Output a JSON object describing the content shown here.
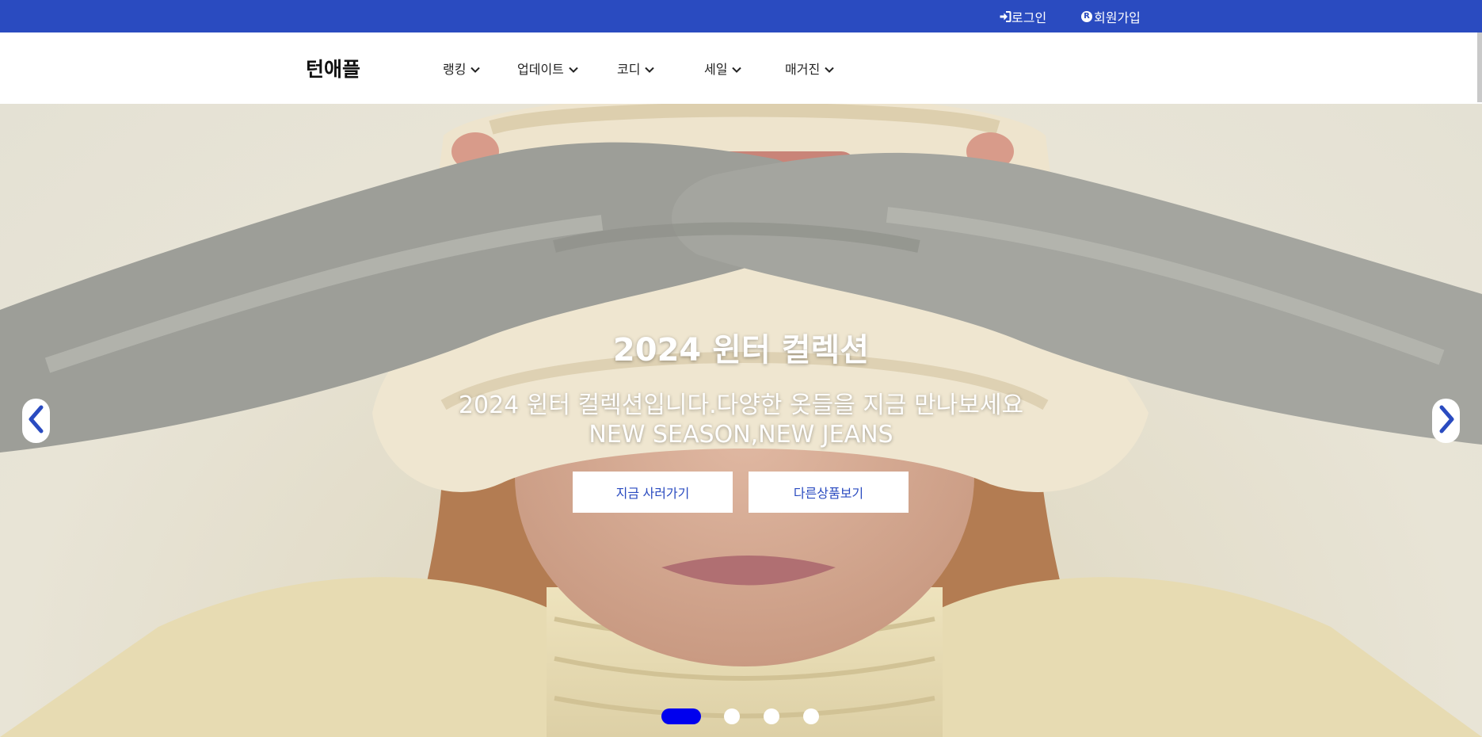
{
  "topbar": {
    "background": "#2a4bc0",
    "login_label": "로그인",
    "login_icon": "sign-in-icon",
    "signup_label": "회원가입",
    "signup_icon": "registered-icon",
    "signup_badge": "R"
  },
  "header": {
    "brand": "턴애플",
    "nav": [
      {
        "label": "랭킹",
        "icon": "chevron-down-icon"
      },
      {
        "label": "업데이트",
        "icon": "chevron-down-icon"
      },
      {
        "label": "코디",
        "icon": "chevron-down-icon"
      },
      {
        "label": "세일",
        "icon": "chevron-down-icon"
      },
      {
        "label": "매거진",
        "icon": "chevron-down-icon"
      }
    ]
  },
  "hero": {
    "title": "2024 윈터 컬렉션",
    "subtitle_line1": "2024 윈터 컬렉션입니다.다양한 옷들을 지금 만나보세요",
    "subtitle_line2": "NEW SEASON,NEW JEANS",
    "buttons": {
      "buy": "지금 사러가기",
      "other": "다른상품보기"
    },
    "prev_icon": "chevron-left-icon",
    "next_icon": "chevron-right-icon",
    "slide_count": 4,
    "active_slide": 1,
    "accent": "#0000ee",
    "button_text_color": "#2a4bc0"
  }
}
